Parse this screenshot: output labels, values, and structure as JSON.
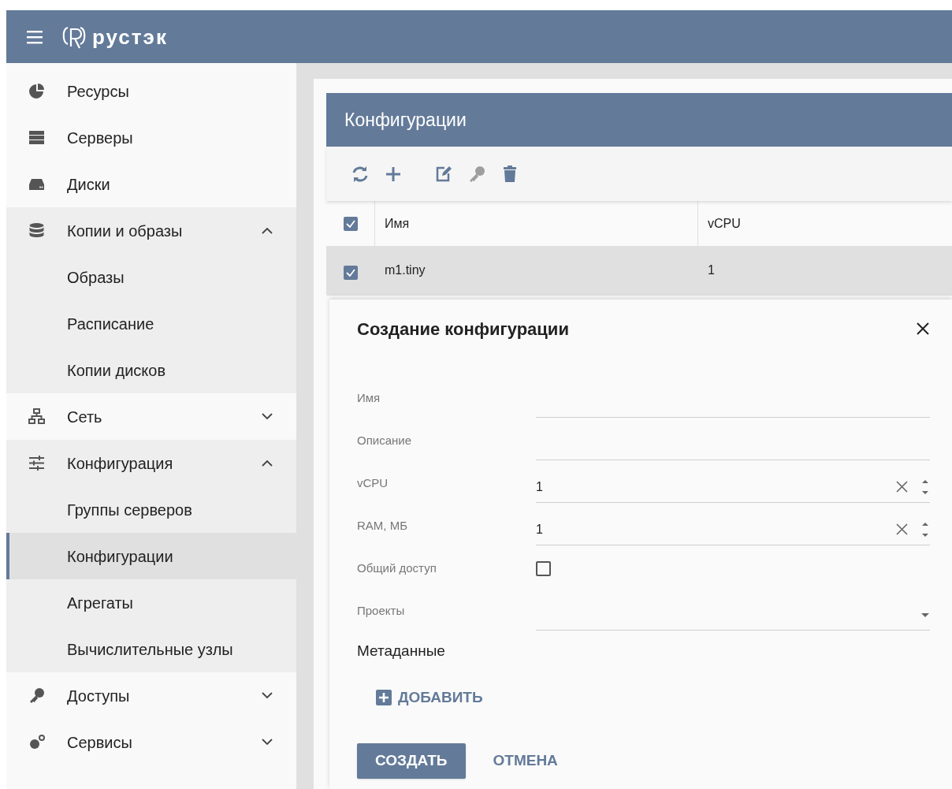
{
  "header": {
    "logo_text": "рустэк"
  },
  "sidebar": {
    "items": [
      {
        "kind": "item",
        "label": "Ресурсы",
        "selected": false
      },
      {
        "kind": "item",
        "label": "Серверы",
        "selected": false
      },
      {
        "kind": "item",
        "label": "Диски",
        "selected": false
      },
      {
        "kind": "group",
        "label": "Копии и образы",
        "expanded": true,
        "children": [
          {
            "label": "Образы",
            "selected": false
          },
          {
            "label": "Расписание",
            "selected": false
          },
          {
            "label": "Копии дисков",
            "selected": false
          }
        ]
      },
      {
        "kind": "group",
        "label": "Сеть",
        "expanded": false
      },
      {
        "kind": "group",
        "label": "Конфигурация",
        "expanded": true,
        "children": [
          {
            "label": "Группы серверов",
            "selected": false
          },
          {
            "label": "Конфигурации",
            "selected": true
          },
          {
            "label": "Агрегаты",
            "selected": false
          },
          {
            "label": "Вычислительные узлы",
            "selected": false
          }
        ]
      },
      {
        "kind": "group",
        "label": "Доступы",
        "expanded": false
      },
      {
        "kind": "group",
        "label": "Сервисы",
        "expanded": false
      }
    ]
  },
  "card": {
    "title": "Конфигурации",
    "toolbar": [
      {
        "kind": "refresh",
        "disabled": false
      },
      {
        "kind": "add",
        "disabled": false
      },
      {
        "kind": "edit",
        "disabled": false
      },
      {
        "kind": "key",
        "disabled": true
      },
      {
        "kind": "delete",
        "disabled": false
      }
    ],
    "table": {
      "all_checked": true,
      "columns": [
        "Имя",
        "vCPU"
      ],
      "rows": [
        {
          "cells": [
            "m1.tiny",
            "1"
          ],
          "checked": true,
          "selected": true
        }
      ]
    }
  },
  "dialog": {
    "title": "Создание конфигурации",
    "fields": [
      {
        "kind": "text",
        "label": "Имя"
      },
      {
        "kind": "text",
        "label": "Описание"
      },
      {
        "kind": "number",
        "label": "vCPU",
        "value": "1"
      },
      {
        "kind": "number",
        "label": "RAM, МБ",
        "value": "1"
      },
      {
        "kind": "checkbox",
        "label": "Общий доступ",
        "checked": false
      },
      {
        "kind": "select",
        "label": "Проекты"
      }
    ],
    "section_title": "Метаданные",
    "add_button": "ДОБАВИТЬ",
    "submit_button": "СОЗДАТЬ",
    "cancel_button": "ОТМЕНА"
  }
}
